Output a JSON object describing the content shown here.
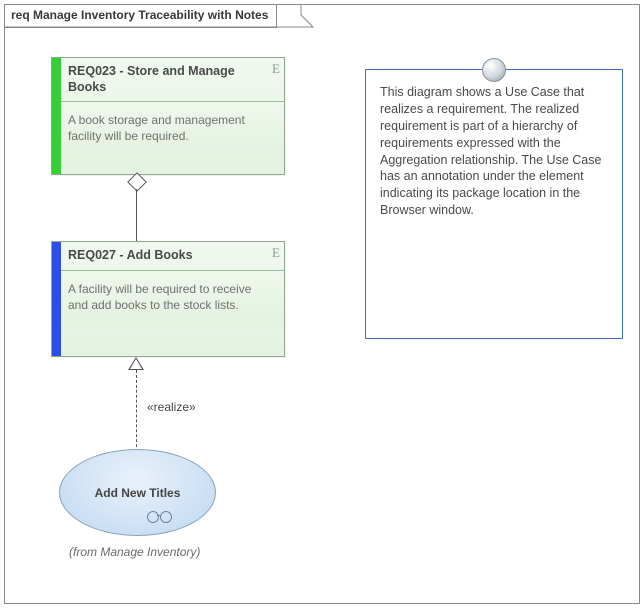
{
  "frame": {
    "title": "req Manage Inventory Traceability with Notes"
  },
  "req1": {
    "title": "REQ023 - Store and Manage Books",
    "body": "A book storage and management facility will be required.",
    "marker": "E"
  },
  "req2": {
    "title": "REQ027 - Add Books",
    "body": "A facility will be required to receive and add books to the stock lists.",
    "marker": "E"
  },
  "note": {
    "text": "This diagram shows a Use Case that realizes a requirement. The realized requirement is part of a hierarchy of requirements expressed with the Aggregation relationship. The Use Case has an annotation under the element indicating its package location in the Browser window."
  },
  "usecase": {
    "name": "Add New Titles",
    "from": "(from Manage Inventory)"
  },
  "relations": {
    "realize_label": "«realize»"
  }
}
